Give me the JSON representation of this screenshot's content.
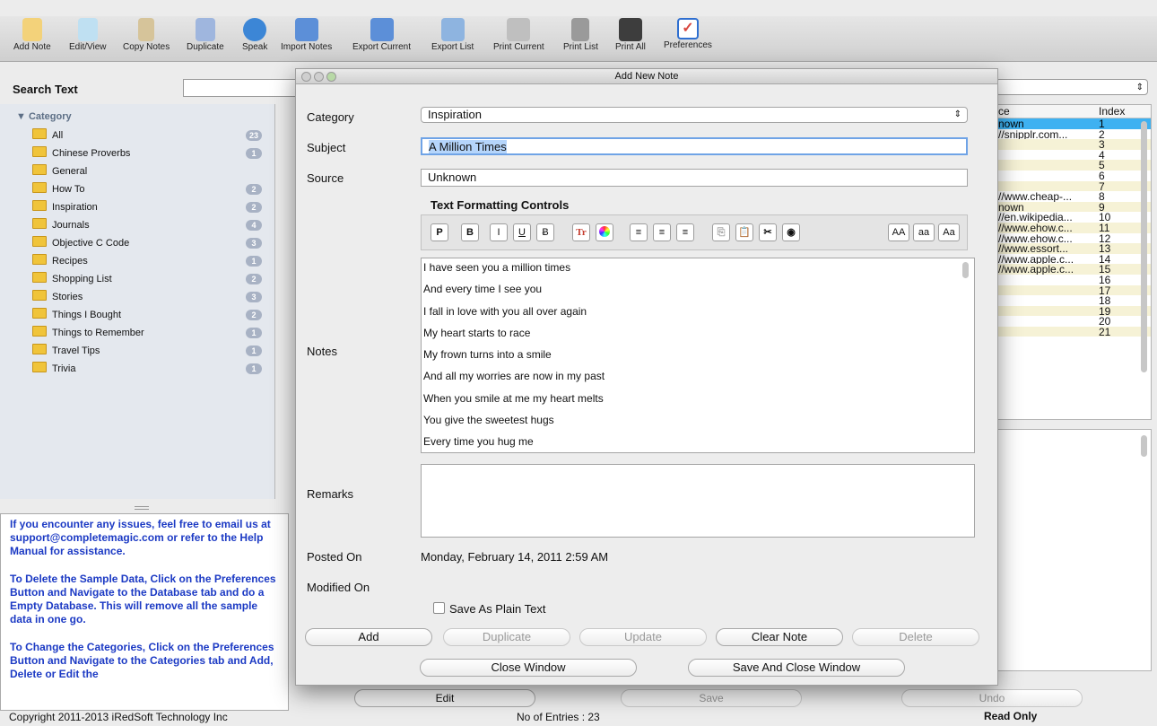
{
  "toolbar": {
    "items": [
      {
        "label": "Add Note",
        "icon": "add-note-icon",
        "color": "#f3d27a"
      },
      {
        "label": "Edit/View",
        "icon": "edit-view-icon",
        "color": "#bfe0f2"
      },
      {
        "label": "Copy Notes",
        "icon": "copy-notes-icon",
        "color": "#d6c49a"
      },
      {
        "label": "Duplicate",
        "icon": "duplicate-icon",
        "color": "#9fb6de"
      },
      {
        "label": "Speak",
        "icon": "speak-icon",
        "color": "#3c86d6"
      },
      {
        "label": "Import Notes",
        "icon": "import-notes-icon",
        "color": "#5c8fd8"
      },
      {
        "label": "Export Current",
        "icon": "export-current-icon",
        "color": "#5c8fd8"
      },
      {
        "label": "Export List",
        "icon": "export-list-icon",
        "color": "#8eb4e0"
      },
      {
        "label": "Print Current",
        "icon": "print-current-icon",
        "color": "#bfbfbf"
      },
      {
        "label": "Print List",
        "icon": "print-list-icon",
        "color": "#9a9a9a"
      },
      {
        "label": "Print All",
        "icon": "print-all-icon",
        "color": "#3d3d3d"
      },
      {
        "label": "Preferences",
        "icon": "preferences-icon",
        "color": "#d9473f"
      }
    ]
  },
  "search": {
    "label": "Search Text",
    "value": ""
  },
  "categories": {
    "header": "▼ Category",
    "items": [
      {
        "name": "All",
        "count": "23"
      },
      {
        "name": "Chinese Proverbs",
        "count": "1"
      },
      {
        "name": "General",
        "count": ""
      },
      {
        "name": "How To",
        "count": "2"
      },
      {
        "name": "Inspiration",
        "count": "2"
      },
      {
        "name": "Journals",
        "count": "4"
      },
      {
        "name": "Objective C Code",
        "count": "3"
      },
      {
        "name": "Recipes",
        "count": "1"
      },
      {
        "name": "Shopping List",
        "count": "2"
      },
      {
        "name": "Stories",
        "count": "3"
      },
      {
        "name": "Things I Bought",
        "count": "2"
      },
      {
        "name": "Things to Remember",
        "count": "1"
      },
      {
        "name": "Travel Tips",
        "count": "1"
      },
      {
        "name": "Trivia",
        "count": "1"
      }
    ]
  },
  "info": {
    "paragraphs": [
      "If you encounter any issues, feel free to email us at support@completemagic.com or refer to the Help Manual for assistance.",
      "To Delete the Sample Data, Click on the Preferences Button and Navigate to the Database tab and do a Empty Database. This will remove all the sample data in one go.",
      "To Change the Categories, Click on the Preferences Button and Navigate to the Categories tab and Add, Delete or Edit the"
    ]
  },
  "list": {
    "col_source": "ce",
    "col_index": "Index",
    "rows": [
      {
        "source": "nown",
        "index": "1"
      },
      {
        "source": "//snipplr.com...",
        "index": "2"
      },
      {
        "source": "",
        "index": "3"
      },
      {
        "source": "",
        "index": "4"
      },
      {
        "source": "",
        "index": "5"
      },
      {
        "source": "",
        "index": "6"
      },
      {
        "source": "",
        "index": "7"
      },
      {
        "source": "//www.cheap-...",
        "index": "8"
      },
      {
        "source": "nown",
        "index": "9"
      },
      {
        "source": "//en.wikipedia...",
        "index": "10"
      },
      {
        "source": "//www.ehow.c...",
        "index": "11"
      },
      {
        "source": "//www.ehow.c...",
        "index": "12"
      },
      {
        "source": "//www.essort...",
        "index": "13"
      },
      {
        "source": "//www.apple.c...",
        "index": "14"
      },
      {
        "source": "//www.apple.c...",
        "index": "15"
      },
      {
        "source": "",
        "index": "16"
      },
      {
        "source": "",
        "index": "17"
      },
      {
        "source": "",
        "index": "18"
      },
      {
        "source": "",
        "index": "19"
      },
      {
        "source": "",
        "index": "20"
      },
      {
        "source": "",
        "index": "21"
      }
    ]
  },
  "bottom": {
    "edit": "Edit",
    "save": "Save",
    "undo": "Undo"
  },
  "status": {
    "copyright": "Copyright 2011-2013 iRedSoft Technology Inc",
    "entries": "No of Entries : 23",
    "mode": "Read Only"
  },
  "dialog": {
    "title": "Add New Note",
    "category_label": "Category",
    "category_value": "Inspiration",
    "subject_label": "Subject",
    "subject_value": "A Million Times",
    "source_label": "Source",
    "source_value": "Unknown",
    "formatting_title": "Text Formatting Controls",
    "notes_label": "Notes",
    "notes_lines": [
      "I have seen you a million times",
      "And every time I see you",
      "I fall in love with you all over again",
      "My heart starts to race",
      "My frown turns into a smile",
      "And all my worries are now in my past",
      "When you smile at me my heart melts",
      "You give the sweetest hugs",
      "Every time you hug me"
    ],
    "remarks_label": "Remarks",
    "posted_label": "Posted On",
    "posted_value": "Monday, February 14, 2011 2:59 AM",
    "modified_label": "Modified On",
    "modified_value": "",
    "plain_text_label": "Save As Plain Text",
    "buttons": {
      "add": "Add",
      "duplicate": "Duplicate",
      "update": "Update",
      "clear": "Clear Note",
      "delete": "Delete",
      "close": "Close Window",
      "save_close": "Save And Close Window"
    },
    "format_buttons": {
      "p": "P",
      "b": "B",
      "i": "I",
      "u": "U",
      "s": "Ƀ",
      "tr": "Tr",
      "aa_upper": "AA",
      "aa_lower": "aa",
      "aa_title": "Aa"
    }
  }
}
